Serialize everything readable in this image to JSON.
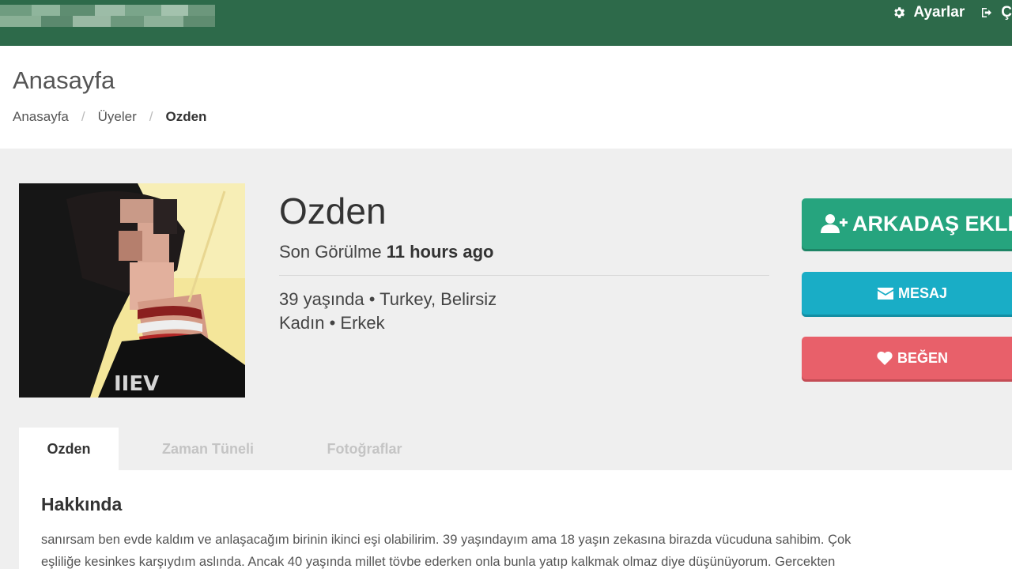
{
  "topbar": {
    "settings_label": "Ayarlar",
    "settings_icon": "gear-icon",
    "logout_icon": "sign-out-icon",
    "logout_label": "Ç"
  },
  "header": {
    "title": "Anasayfa",
    "breadcrumb": [
      "Anasayfa",
      "Üyeler",
      "Ozden"
    ]
  },
  "profile": {
    "name": "Ozden",
    "last_seen_label": "Son Görülme",
    "last_seen_value": "11 hours ago",
    "age_location": "39 yaşında • Turkey, Belirsiz",
    "gender": "Kadın • Erkek"
  },
  "actions": {
    "add_friend": "ARKADAŞ EKLE",
    "message": "MESAJ",
    "like": "BEĞEN"
  },
  "tabs": [
    "Ozden",
    "Zaman Tüneli",
    "Fotoğraflar"
  ],
  "about": {
    "title": "Hakkında",
    "line1": "sanırsam ben evde kaldım ve anlaşacağım birinin ikinci eşi olabilirim. 39 yaşındayım ama 18 yaşın zekasına birazda vücuduna sahibim. Çok",
    "line2": "eşliliğe kesinkes karşıydım aslında. Ancak 40 yaşında millet tövbe ederken onla bunla yatıp kalkmak olmaz diye düşünüyorum. Gercekten"
  },
  "colors": {
    "topbar": "#2d6a4a",
    "add_friend": "#26a47e",
    "message": "#19adc6",
    "like": "#e8606a"
  }
}
